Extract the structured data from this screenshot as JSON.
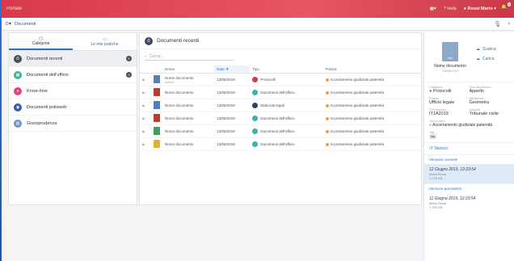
{
  "topbar": {
    "title": "Portale",
    "help": "Help",
    "user": "Rossi Mario",
    "notifications": "3"
  },
  "breadcrumb": {
    "label": "Documenti"
  },
  "tabs": [
    {
      "label": "Categoria"
    },
    {
      "label": "Le mie pratiche"
    }
  ],
  "categories": [
    {
      "label": "Documenti recenti",
      "count": "5",
      "color": "#4a4f57",
      "glyph": "⏱"
    },
    {
      "label": "Documenti dell'ufficio",
      "count": "3",
      "color": "#3ab3a5",
      "glyph": "▦"
    },
    {
      "label": "Know-how",
      "count": "",
      "color": "#e0457b",
      "glyph": "♦"
    },
    {
      "label": "Documenti polisweb",
      "count": "",
      "color": "#3a5aa8",
      "glyph": "◉"
    },
    {
      "label": "Giurisprudenza",
      "count": "",
      "color": "#6f92c7",
      "glyph": "▤"
    }
  ],
  "center": {
    "title": "Documenti recenti",
    "search_placeholder": "Cerca...",
    "columns": {
      "name": "Nome",
      "date": "Data",
      "type": "Tipo",
      "case": "Pratica"
    },
    "rows": [
      {
        "name": "Nome documento",
        "sub": "autore",
        "date": "13/06/2019",
        "type": "Protocolli",
        "type_color": "#d83a4b",
        "file_color": "#5b7fb8",
        "case": "Accertamento giudiziale paternità"
      },
      {
        "name": "Nome documento",
        "sub": "",
        "date": "13/06/2019",
        "type": "Documenti dell'ufficio",
        "type_color": "#3ab3a5",
        "file_color": "#c0392b",
        "case": "Accertamento giudiziale paternità"
      },
      {
        "name": "Nome documento",
        "sub": "",
        "date": "13/06/2019",
        "type": "Elaborati legali",
        "type_color": "#2e3f6e",
        "file_color": "#4a7ec8",
        "case": "Accertamento giudiziale paternità"
      },
      {
        "name": "Nome documento",
        "sub": "",
        "date": "13/06/2019",
        "type": "Documenti dell'ufficio",
        "type_color": "#3ab3a5",
        "file_color": "#c0392b",
        "case": "Accertamento giudiziale paternità"
      },
      {
        "name": "Nome documento",
        "sub": "",
        "date": "13/06/2019",
        "type": "Documenti dell'ufficio",
        "type_color": "#3ab3a5",
        "file_color": "#3a9e5c",
        "case": "Accertamento giudiziale paternità"
      },
      {
        "name": "Nome documento",
        "sub": "",
        "date": "13/06/2019",
        "type": "Documenti dell'ufficio",
        "type_color": "#3ab3a5",
        "file_color": "#e0b030",
        "case": "Accertamento giudiziale paternità"
      }
    ]
  },
  "detail": {
    "file_label": "doc",
    "name": "Nome documento",
    "date": "13/06/2019",
    "download": "Scarica",
    "upload": "Carica",
    "category_label": "Categoria",
    "category": "Protocolli",
    "doctype_label": "Tipo documento",
    "doctype": "Appello",
    "office_label": "Proprio",
    "office": "Ufficio legale",
    "affiliation_label": "Affiliazione",
    "affiliation": "Geometra",
    "protocol_label": "N.Protocollo",
    "protocol": "IT1A2019",
    "court_label": "Autorità",
    "court": "Tribunale civile",
    "case_label": "Tipo pratica",
    "case": "Accertamento giudiziale paternità",
    "tag_label": "Tag",
    "tag": "tag"
  },
  "history": {
    "title": "Storico",
    "current_label": "Versione corrente",
    "current": {
      "date": "12 Giugno 2019, 12:23:54",
      "user": "Mario Rossi",
      "size": "1.753 KB"
    },
    "previous_label": "Versione precedenti",
    "previous": {
      "date": "11 Giugno 2019, 12:23:54",
      "user": "Mario Rossi",
      "size": "1.753 KB"
    }
  }
}
